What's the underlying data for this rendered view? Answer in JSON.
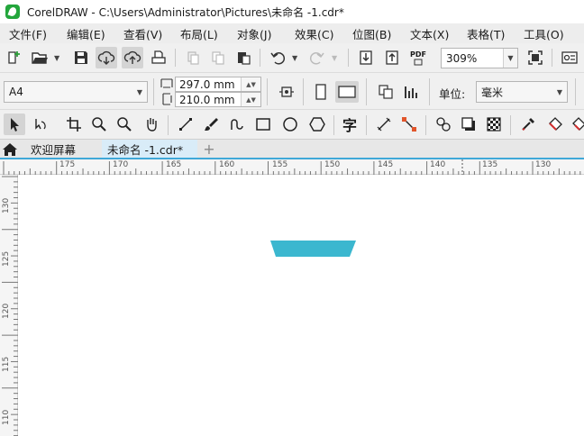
{
  "window": {
    "title": "CorelDRAW - C:\\Users\\Administrator\\Pictures\\未命名 -1.cdr*"
  },
  "menu": [
    "文件(F)",
    "编辑(E)",
    "查看(V)",
    "布局(L)",
    "对象(J)",
    "效果(C)",
    "位图(B)",
    "文本(X)",
    "表格(T)",
    "工具(O)"
  ],
  "toolbar_standard": {
    "zoom_value": "309%",
    "pdf_label": "PDF"
  },
  "property_bar": {
    "page_size": "A4",
    "width": "297.0 mm",
    "height": "210.0 mm",
    "unit_label": "单位:",
    "unit_value": "毫米"
  },
  "toolbox": {
    "text_tool_glyph": "字"
  },
  "tabs": {
    "welcome": "欢迎屏幕",
    "document": "未命名 -1.cdr*",
    "add": "+"
  },
  "rulers": {
    "horizontal": [
      "175",
      "170",
      "165",
      "160",
      "155",
      "150",
      "145",
      "140",
      "135",
      "130"
    ],
    "vertical": [
      "130",
      "125",
      "120",
      "115",
      "110"
    ]
  },
  "colors": {
    "shape_fill": "#3bb7cf",
    "tab_accent": "#3fa8d8",
    "app_green": "#23a63c"
  },
  "icons": {
    "new": "new-document-icon",
    "open": "open-folder-icon",
    "save": "save-icon",
    "import": "import-icon",
    "export": "export-icon",
    "pick": "pick-tool-icon",
    "zoom": "zoom-tool-icon"
  }
}
